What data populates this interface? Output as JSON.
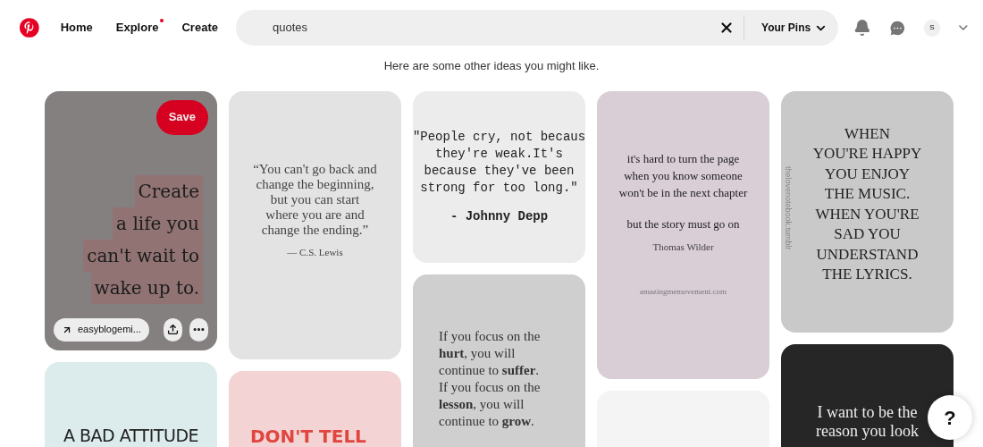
{
  "nav": {
    "items": [
      {
        "label": "Home"
      },
      {
        "label": "Explore",
        "dot": true
      },
      {
        "label": "Create"
      }
    ]
  },
  "search": {
    "value": "quotes",
    "scope": "Your Pins"
  },
  "avatar": {
    "initial": "S"
  },
  "message": "Here are some other ideas you might like.",
  "columns": [
    {
      "pins": [
        {
          "kind": "highlight",
          "hovered": true,
          "lines": [
            "Create",
            "a life you",
            "can't wait to",
            "wake up to."
          ],
          "save": "Save",
          "link": "easyblogemi..."
        },
        {
          "kind": "bold-caps",
          "hovered": false,
          "lines": [
            "A BAD ATTITUDE"
          ]
        }
      ]
    },
    {
      "pins": [
        {
          "kind": "serif",
          "hovered": false,
          "lines": [
            "“You can't go back and",
            "change the beginning,",
            "but you can start",
            "where you are and",
            "change the ending.”"
          ],
          "attribution": "— C.S. Lewis"
        },
        {
          "kind": "pink",
          "hovered": false,
          "lines": [
            "DON'T TELL"
          ]
        }
      ]
    },
    {
      "pins": [
        {
          "kind": "typewriter",
          "hovered": false,
          "lines": [
            "\"People cry, not becaus",
            "they're weak.It's",
            "because they've been",
            "strong for too long.\""
          ],
          "attribution": "- Johnny Depp"
        },
        {
          "kind": "focus",
          "hovered": false,
          "lines": [
            "If you focus on the",
            "**hurt**, you will",
            "continue to **suffer**.",
            "If you focus on the",
            "**lesson**, you will",
            "continue to **grow**."
          ]
        }
      ]
    },
    {
      "pins": [
        {
          "kind": "paper",
          "hovered": false,
          "lines": [
            "it's hard to turn the page",
            "when you know someone",
            "won't be in the next chapter"
          ],
          "lines_2": [
            "but the story must go on"
          ],
          "attribution": "Thomas Wilder",
          "source": "amazingmemovement.com"
        },
        {
          "kind": "blank",
          "hovered": false
        }
      ]
    },
    {
      "pins": [
        {
          "kind": "caps",
          "hovered": false,
          "lines": [
            "WHEN",
            "YOU'RE HAPPY",
            "YOU ENJOY",
            "THE MUSIC.",
            "WHEN YOU'RE",
            "SAD YOU",
            "UNDERSTAND",
            "THE LYRICS."
          ],
          "source": "thelovenotebook.tumblr"
        },
        {
          "kind": "dark",
          "hovered": false,
          "lines": [
            "I want to be the",
            "reason you look"
          ]
        }
      ]
    }
  ],
  "help": "?"
}
